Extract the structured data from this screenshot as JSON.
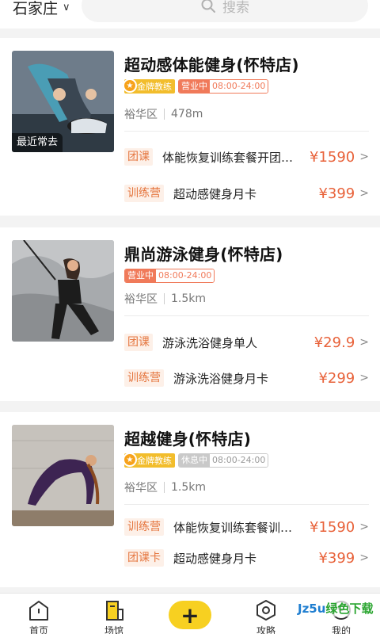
{
  "header": {
    "city": "石家庄",
    "search_placeholder": "搜索"
  },
  "venues": [
    {
      "title": "超动感体能健身(怀特店)",
      "gold_coach": "金牌教练",
      "status_label": "营业中",
      "hours": "08:00-24:00",
      "district": "裕华区",
      "distance": "478m",
      "recent_label": "最近常去",
      "deals": [
        {
          "tag": "团课",
          "name": "体能恢复训练套餐开团…",
          "price": "¥1590"
        },
        {
          "tag": "训练营",
          "name": "超动感健身月卡",
          "price": "¥399"
        }
      ]
    },
    {
      "title": "鼎尚游泳健身(怀特店)",
      "status_label": "营业中",
      "hours": "08:00-24:00",
      "district": "裕华区",
      "distance": "1.5km",
      "deals": [
        {
          "tag": "团课",
          "name": "游泳洗浴健身单人",
          "price": "¥29.9"
        },
        {
          "tag": "训练营",
          "name": "游泳洗浴健身月卡",
          "price": "¥299"
        }
      ]
    },
    {
      "title": "超越健身(怀特店)",
      "gold_coach": "金牌教练",
      "status_label": "休息中",
      "hours": "08:00-24:00",
      "district": "裕华区",
      "distance": "1.5km",
      "deals": [
        {
          "tag": "训练营",
          "name": "体能恢复训练套餐训…",
          "price": "¥1590"
        },
        {
          "tag": "团课卡",
          "name": "超动感健身月卡",
          "price": "¥399"
        }
      ]
    }
  ],
  "bottom_nav": {
    "home": "首页",
    "venue": "场馆",
    "add": "+",
    "guide": "攻略",
    "mine": "我的"
  },
  "watermark": {
    "part1": "Jz5u",
    "part2": "绿色下载"
  },
  "colors": {
    "accent": "#f7d021",
    "price": "#e8623a",
    "gold": "#f2bd2c",
    "open": "#f07a5a",
    "closed": "#c9c9c9"
  }
}
